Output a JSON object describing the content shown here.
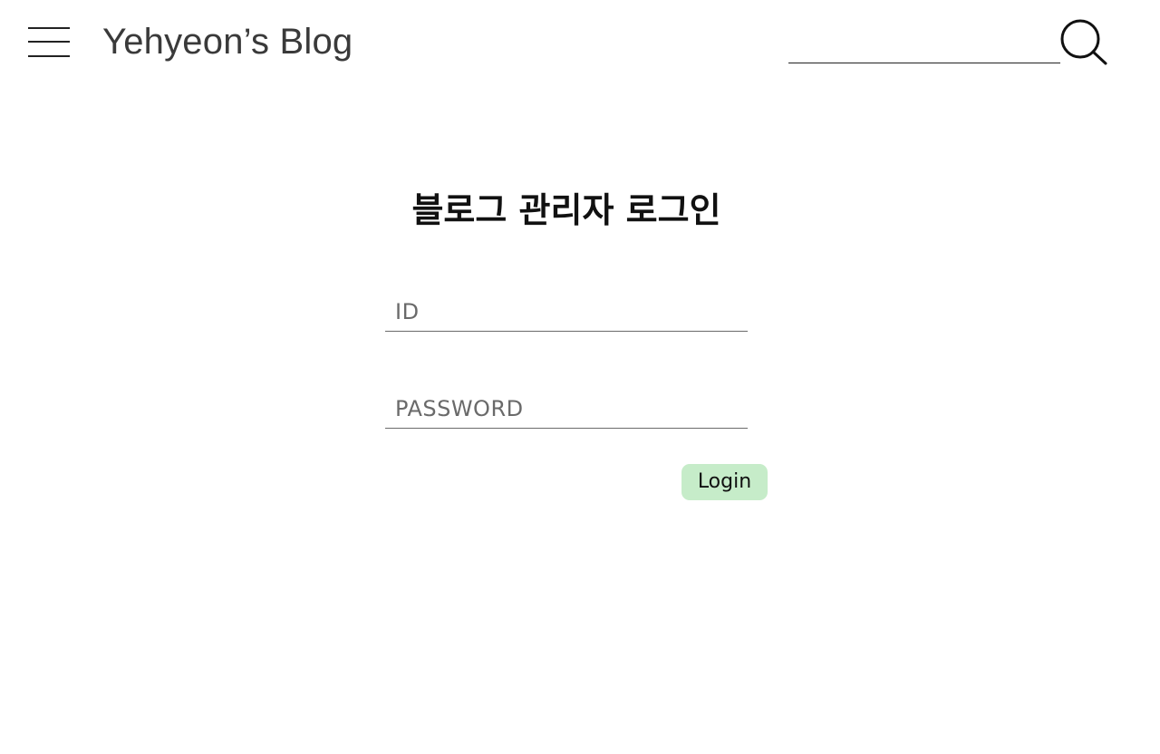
{
  "header": {
    "site_title": "Yehyeon’s Blog",
    "search": {
      "value": "",
      "placeholder": ""
    },
    "icons": {
      "menu": "hamburger-menu-icon",
      "search": "magnifier-search-icon"
    }
  },
  "login": {
    "title": "블로그 관리자 로그인",
    "id_field": {
      "value": "",
      "placeholder": "ID"
    },
    "password_field": {
      "value": "",
      "placeholder": "PASSWORD"
    },
    "submit_label": "Login"
  },
  "colors": {
    "background": "#ffffff",
    "login_button_bg": "#c6ecc9",
    "text_primary": "#111111",
    "title_text": "#3a3a3a"
  }
}
